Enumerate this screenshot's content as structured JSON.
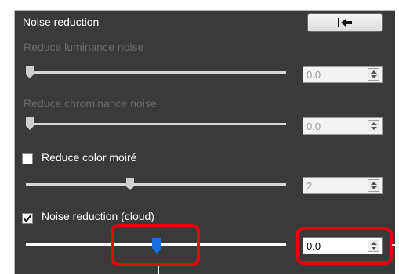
{
  "panel": {
    "title": "Noise reduction",
    "reset_icon": "reset-arrow-icon"
  },
  "controls": [
    {
      "label": "Reduce luminance noise",
      "value": "0.0",
      "enabled": false,
      "slider_fraction": 0.0
    },
    {
      "label": "Reduce chrominance noise",
      "value": "0.0",
      "enabled": false,
      "slider_fraction": 0.0
    },
    {
      "label": "Reduce color moiré",
      "value": "2",
      "enabled": false,
      "checked": false,
      "slider_fraction": 0.4
    },
    {
      "label": "Noise reduction (cloud)",
      "value": "0.0",
      "enabled": true,
      "checked": true,
      "slider_fraction": 0.5
    }
  ],
  "colors": {
    "panel_bg": "#3a3a3a",
    "highlight": "#e8000f",
    "thumb_active": "#1a6fe0"
  }
}
